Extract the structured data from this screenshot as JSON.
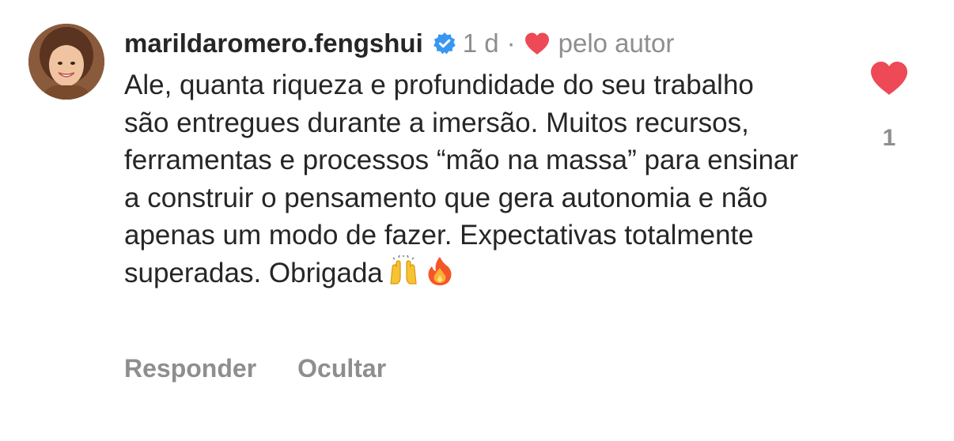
{
  "comment": {
    "username": "marildaromero.fengshui",
    "verified_icon": "verified-badge-icon",
    "time": "1 d",
    "separator": "·",
    "liked_by_author_label": "pelo autor",
    "text": "Ale, quanta riqueza e profundidade do seu trabalho são entregues durante a imersão. Muitos recursos, ferramentas e processos “mão na massa” para ensinar a construir o pensamento que gera autonomia e não apenas um modo de fazer. Expectativas totalmente superadas. Obrigada",
    "emojis": [
      "raising-hands-emoji",
      "fire-emoji"
    ],
    "like_count": "1"
  },
  "actions": {
    "reply_label": "Responder",
    "hide_label": "Ocultar"
  },
  "colors": {
    "heart_red": "#ed4956",
    "verified_blue": "#3897f0",
    "secondary_text": "#8e8e8e",
    "primary_text": "#262626"
  }
}
